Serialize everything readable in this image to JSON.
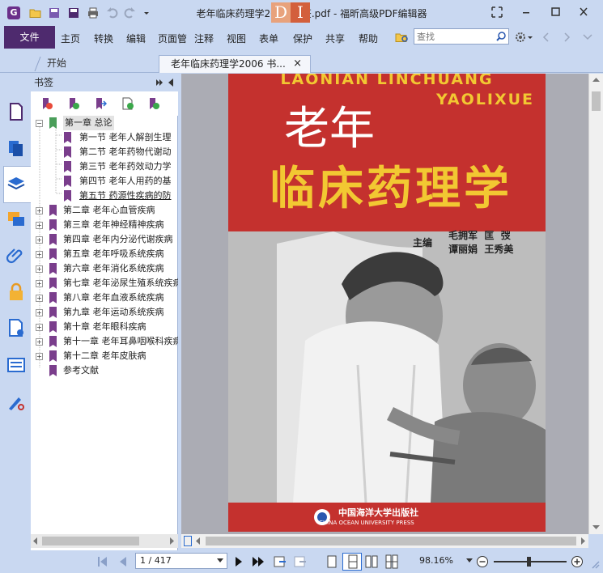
{
  "window": {
    "title": "老年临床药理学2006 书签.pdf - 福昕高级PDF编辑器",
    "watermark_d": "D",
    "watermark_i": "I"
  },
  "app_logo": "G",
  "menu": {
    "file": "文件",
    "items": [
      "主页",
      "转换",
      "编辑",
      "页面管",
      "注释",
      "视图",
      "表单",
      "保护",
      "共享",
      "帮助"
    ],
    "search_placeholder": "查找"
  },
  "tabs": [
    {
      "label": "开始"
    },
    {
      "label": "老年临床药理学2006 书...",
      "close": "×"
    }
  ],
  "panel": {
    "title": "书签"
  },
  "bookmarks": {
    "root": {
      "label": "第一章 总论",
      "toggle": "−"
    },
    "children": [
      "第一节 老年人解剖生理",
      "第二节 老年药物代谢动",
      "第三节 老年药效动力学",
      "第四节 老年人用药的基",
      "第五节 药源性疾病的防"
    ],
    "chapters": [
      "第二章 老年心血管疾病",
      "第三章 老年神经精神疾病",
      "第四章 老年内分泌代谢疾病",
      "第五章 老年呼吸系统疾病",
      "第六章 老年消化系统疾病",
      "第七章 老年泌尿生殖系统疾病",
      "第八章 老年血液系统疾病",
      "第九章 老年运动系统疾病",
      "第十章 老年眼科疾病",
      "第十一章 老年耳鼻咽喉科疾病",
      "第十二章 老年皮肤病"
    ],
    "expand_glyph": "+",
    "last": "参考文献"
  },
  "cover": {
    "pinyin_line1": "LAONIAN LINCHUANG",
    "pinyin_line2": "YAOLIXUE",
    "title_top": "老年",
    "title_bottom": "临床药理学",
    "editors_label": "主编",
    "editors_row1": "毛拥军  匡  弢",
    "editors_row2": "谭丽娟  王秀美",
    "publisher_cn": "中国海洋大学出版社",
    "publisher_en": "CHINA OCEAN UNIVERSITY PRESS"
  },
  "status": {
    "page_display": "1 / 417",
    "zoom": "98.16%"
  },
  "colors": {
    "chrome": "#c9d8f1",
    "file_button": "#4e2a6e",
    "cover_red": "#c4312e",
    "cover_title_yellow": "#f2c832",
    "canvas_gray": "#abacb4",
    "bookmark_icon": "#7a3e8c"
  }
}
